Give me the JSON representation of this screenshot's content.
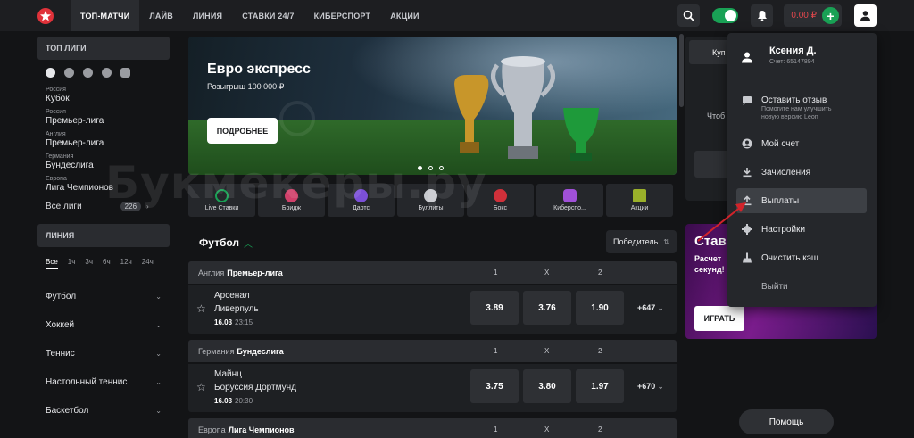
{
  "header": {
    "nav": [
      "ТОП-МАТЧИ",
      "ЛАЙВ",
      "ЛИНИЯ",
      "СТАВКИ 24/7",
      "КИБЕРСПОРТ",
      "АКЦИИ"
    ],
    "balance": "0.00 ₽",
    "plus": "+"
  },
  "sidebar": {
    "top_leagues_title": "ТОП ЛИГИ",
    "leagues": [
      {
        "country": "Россия",
        "name": "Кубок"
      },
      {
        "country": "Россия",
        "name": "Премьер-лига"
      },
      {
        "country": "Англия",
        "name": "Премьер-лига"
      },
      {
        "country": "Германия",
        "name": "Бундеслига"
      },
      {
        "country": "Европа",
        "name": "Лига Чемпионов"
      }
    ],
    "all_leagues": "Все лиги",
    "all_leagues_count": "226",
    "line_title": "ЛИНИЯ",
    "hours": [
      "Все",
      "1ч",
      "3ч",
      "6ч",
      "12ч",
      "24ч"
    ],
    "sports": [
      "Футбол",
      "Хоккей",
      "Теннис",
      "Настольный теннис",
      "Баскетбол"
    ]
  },
  "banner": {
    "title": "Евро экспресс",
    "subtitle": "Розыгрыш 100 000 ₽",
    "button": "ПОДРОБНЕЕ"
  },
  "sport_tiles": [
    "Live Ставки",
    "Бридж",
    "Дартс",
    "Буллиты",
    "Бокс",
    "Киберспо...",
    "Акции"
  ],
  "football": {
    "title": "Футбол",
    "winner_select": "Победитель",
    "col_headers": [
      "1",
      "X",
      "2"
    ],
    "matches": [
      {
        "country": "Англия",
        "league": "Премьер-лига",
        "team1": "Арсенал",
        "team2": "Ливерпуль",
        "date": "16.03",
        "time": "23:15",
        "odds": [
          "3.89",
          "3.76",
          "1.90"
        ],
        "more": "+647"
      },
      {
        "country": "Германия",
        "league": "Бундеслига",
        "team1": "Майнц",
        "team2": "Боруссия Дортмунд",
        "date": "16.03",
        "time": "20:30",
        "odds": [
          "3.75",
          "3.80",
          "1.97"
        ],
        "more": "+670"
      },
      {
        "country": "Европа",
        "league": "Лига Чемпионов"
      }
    ]
  },
  "coupon": {
    "tab": "Куп",
    "text": "Чтоб"
  },
  "promo": {
    "title": "Став",
    "sub1": "Расчет",
    "sub2": "секунд!",
    "button": "ИГРАТЬ"
  },
  "help": "Помощь",
  "user_menu": {
    "name": "Ксения Д.",
    "account": "Счет: 65147894",
    "feedback": "Оставить отзыв",
    "feedback_sub": "Помогите нам улучшить новую версию Leon",
    "items": [
      "Мой счет",
      "Зачисления",
      "Выплаты",
      "Настройки",
      "Очистить кэш",
      "Выйти"
    ]
  },
  "watermark": "Букмекеры.ру",
  "colors": {
    "accent_green": "#19a155",
    "balance_red": "#e0474c",
    "arrow_red": "#d2232a"
  }
}
